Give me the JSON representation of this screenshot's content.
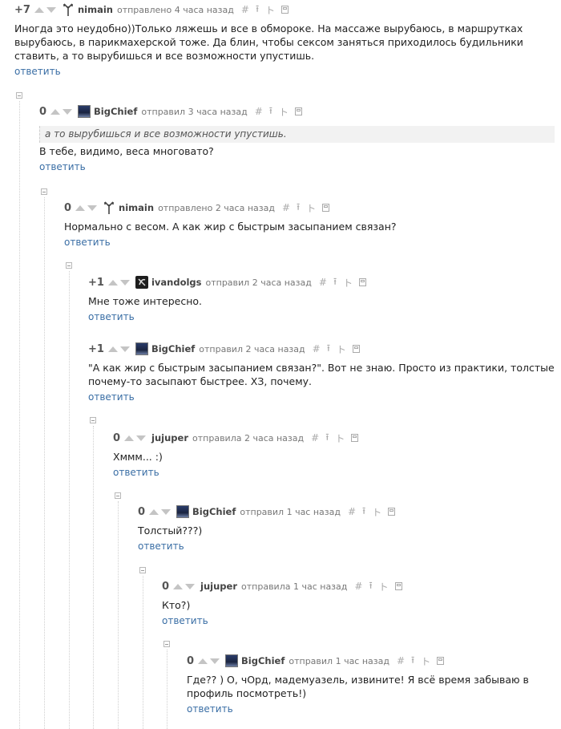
{
  "ui": {
    "reply_label": "ответить",
    "anchor_icon": "#",
    "tool_icons": [
      "parent-comment-icon",
      "thread-icon",
      "save-icon"
    ]
  },
  "comments": [
    {
      "rating": "+7",
      "author": "nimain",
      "avatar": "trident-avatar",
      "meta": "отправлено 4 часа назад",
      "quote": "",
      "text": "Иногда это неудобно))Только ляжешь и все в обмороке. На массаже вырубаюсь, в маршрутках вырубаюсь, в парикмахерской тоже. Да блин, чтобы сексом заняться приходилось будильники ставить, а то вырубишься и все возможности упустишь."
    },
    {
      "rating": "0",
      "author": "BigChief",
      "avatar": "bigchief-avatar",
      "meta": "отправил 3 часа назад",
      "quote": "а то вырубишься и все возможности упустишь.",
      "text": "В тебе, видимо, веса многовато?"
    },
    {
      "rating": "0",
      "author": "nimain",
      "avatar": "trident-avatar",
      "meta": "отправлено 2 часа назад",
      "quote": "",
      "text": "Нормально с весом. А как жир с быстрым засыпанием связан?"
    },
    {
      "rating": "+1",
      "author": "ivandolgs",
      "avatar": "ivandolgs-avatar",
      "meta": "отправил 2 часа назад",
      "quote": "",
      "text": "Мне тоже интересно."
    },
    {
      "rating": "+1",
      "author": "BigChief",
      "avatar": "bigchief-avatar",
      "meta": "отправил 2 часа назад",
      "quote": "",
      "text": "\"А как жир с быстрым засыпанием связан?\". Вот не знаю. Просто из практики, толстые почему-то засыпают быстрее. ХЗ, почему."
    },
    {
      "rating": "0",
      "author": "jujuper",
      "avatar": "",
      "meta": "отправила 2 часа назад",
      "quote": "",
      "text": "Хммм... :)"
    },
    {
      "rating": "0",
      "author": "BigChief",
      "avatar": "bigchief-avatar",
      "meta": "отправил 1 час назад",
      "quote": "",
      "text": "Толстый???)"
    },
    {
      "rating": "0",
      "author": "jujuper",
      "avatar": "",
      "meta": "отправила 1 час назад",
      "quote": "",
      "text": "Кто?)"
    },
    {
      "rating": "0",
      "author": "BigChief",
      "avatar": "bigchief-avatar",
      "meta": "отправил 1 час назад",
      "quote": "",
      "text": "Где?? ) О, чОрд, мадемуазель, извините! Я всё время забываю в профиль посмотреть!)"
    }
  ]
}
